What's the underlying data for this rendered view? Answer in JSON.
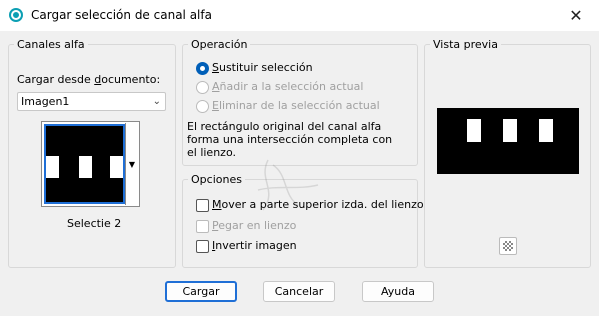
{
  "window": {
    "title": "Cargar selección de canal alfa",
    "close_symbol": "✕"
  },
  "alpha_channels": {
    "group_label": "Canales alfa",
    "load_from_label": "Cargar desde documento:",
    "document_value": "Imagen1",
    "selected_channel_name": "Selectie 2"
  },
  "operation": {
    "group_label": "Operación",
    "options": [
      {
        "label": "Sustituir selección",
        "checked": true,
        "disabled": false
      },
      {
        "label": "Añadir a la selección actual",
        "checked": false,
        "disabled": true
      },
      {
        "label": "Eliminar de la selección actual",
        "checked": false,
        "disabled": true
      }
    ],
    "description_line1": "El rectángulo original del canal alfa",
    "description_line2": "forma una intersección completa con",
    "description_line3": "el lienzo."
  },
  "options": {
    "group_label": "Opciones",
    "items": [
      {
        "label": "Mover a parte superior izda. del lienzo",
        "checked": false,
        "disabled": false
      },
      {
        "label": "Pegar en lienzo",
        "checked": false,
        "disabled": true
      },
      {
        "label": "Invertir imagen",
        "checked": false,
        "disabled": false
      }
    ]
  },
  "preview": {
    "group_label": "Vista previa",
    "transparency_icon": "checkerboard-icon"
  },
  "buttons": {
    "load": "Cargar",
    "cancel": "Cancelar",
    "help": "Ayuda"
  },
  "colors": {
    "accent": "#005fb8",
    "focus_border": "#1f6fd6",
    "dialog_bg": "#f0f0f0"
  }
}
